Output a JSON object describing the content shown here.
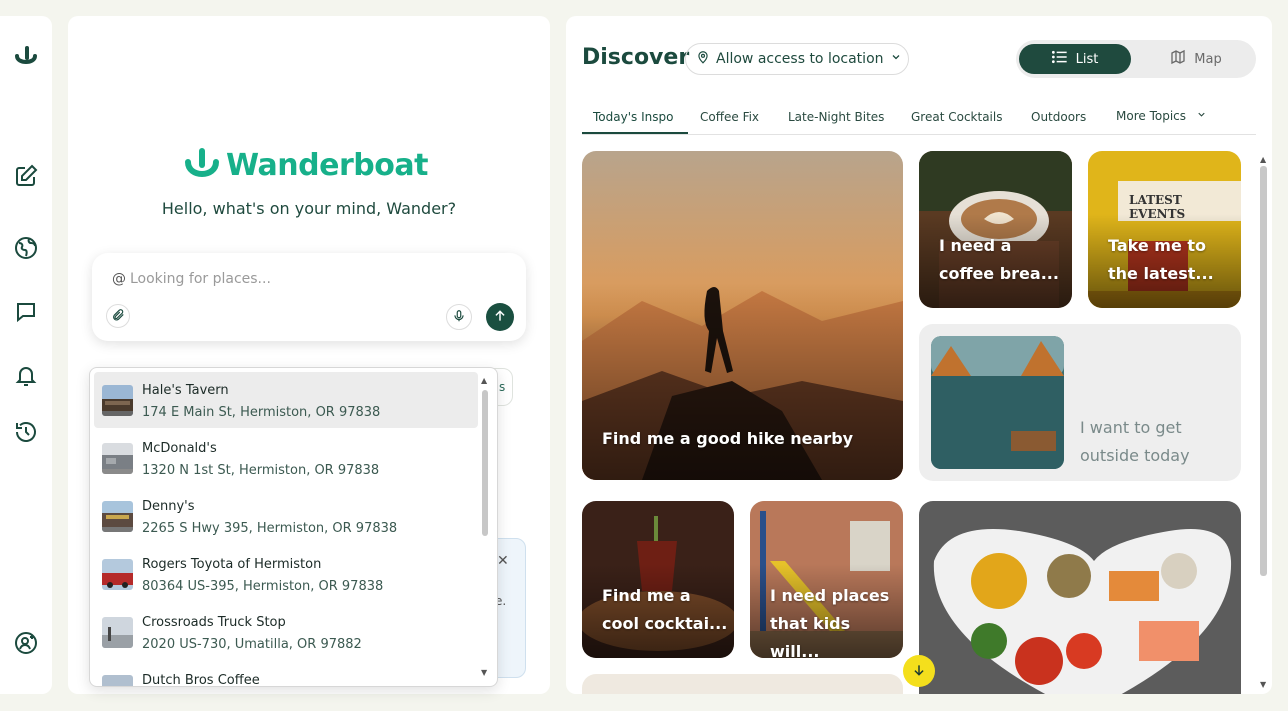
{
  "rail": {
    "icons": [
      "wanderboat-logo-icon",
      "new-chat-icon",
      "explore-globe-icon",
      "chat-bubble-icon",
      "notification-bell-icon",
      "history-icon",
      "add-user-icon"
    ]
  },
  "chat": {
    "brand": "Wanderboat",
    "greeting": "Hello, what's on your mind, Wander?",
    "at_symbol": "@",
    "placeholder": "Looking for places...",
    "promo_text": "e."
  },
  "dropdown": {
    "items": [
      {
        "name": "Hale's Tavern",
        "address": "174 E Main St, Hermiston, OR 97838",
        "selected": true
      },
      {
        "name": "McDonald's",
        "address": "1320 N 1st St, Hermiston, OR 97838",
        "selected": false
      },
      {
        "name": "Denny's",
        "address": "2265 S Hwy 395, Hermiston, OR 97838",
        "selected": false
      },
      {
        "name": "Rogers Toyota of Hermiston",
        "address": "80364 US-395, Hermiston, OR 97838",
        "selected": false
      },
      {
        "name": "Crossroads Truck Stop",
        "address": "2020 US-730, Umatilla, OR 97882",
        "selected": false
      },
      {
        "name": "Dutch Bros Coffee",
        "address": "",
        "selected": false
      }
    ]
  },
  "discover": {
    "title": "Discover",
    "location_label": "Allow access to location",
    "view_list": "List",
    "view_map": "Map",
    "tabs": [
      "Today's Inspo",
      "Coffee Fix",
      "Late-Night Bites",
      "Great Cocktails",
      "Outdoors",
      "More Topics"
    ],
    "active_tab": "Today's Inspo",
    "cards": {
      "hike": [
        "Find me a good hike nearby"
      ],
      "coffee": [
        "I need a",
        "coffee brea..."
      ],
      "events": [
        "Take me to",
        "the latest..."
      ],
      "events_sign": "LATEST EVENTS",
      "outside": [
        "I want to get",
        "outside today"
      ],
      "cocktail": [
        "Find me a",
        "cool cocktai..."
      ],
      "kids": [
        "I need places",
        "that kids will..."
      ]
    }
  }
}
